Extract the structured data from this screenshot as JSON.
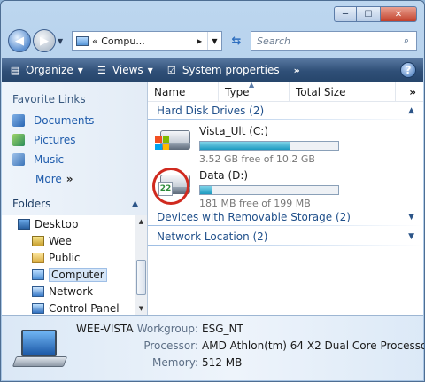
{
  "window": {
    "caption_buttons": {
      "minimize": "─",
      "maximize": "☐",
      "close": "✕"
    }
  },
  "addressbar": {
    "prefix": "«",
    "crumb": "Compu...",
    "search_placeholder": "Search"
  },
  "toolbar": {
    "organize": "Organize",
    "views": "Views",
    "system_properties": "System properties",
    "more": "»",
    "help": "?"
  },
  "favorites": {
    "title": "Favorite Links",
    "items": [
      {
        "label": "Documents",
        "icon": "documents-icon"
      },
      {
        "label": "Pictures",
        "icon": "pictures-icon"
      },
      {
        "label": "Music",
        "icon": "music-icon"
      }
    ],
    "more": "More",
    "more_glyph": "»"
  },
  "folders": {
    "title": "Folders",
    "tree": [
      {
        "label": "Desktop",
        "level": 0
      },
      {
        "label": "Wee",
        "level": 1
      },
      {
        "label": "Public",
        "level": 1
      },
      {
        "label": "Computer",
        "level": 1,
        "selected": true
      },
      {
        "label": "Network",
        "level": 1
      },
      {
        "label": "Control Panel",
        "level": 1
      }
    ]
  },
  "columns": {
    "name": "Name",
    "type": "Type",
    "total_size": "Total Size",
    "more": "»"
  },
  "groups": {
    "hard_disk": "Hard Disk Drives (2)",
    "removable": "Devices with Removable Storage (2)",
    "network": "Network Location (2)"
  },
  "drives": [
    {
      "name": "Vista_Ult (C:)",
      "free": "3.52 GB free of 10.2 GB",
      "used_fraction": 0.655
    },
    {
      "name": "Data (D:)",
      "free": "181 MB free of 199 MB",
      "used_fraction": 0.09
    }
  ],
  "details": {
    "computer_name": "WEE-VISTA",
    "workgroup_label": "Workgroup:",
    "workgroup": "ESG_NT",
    "processor_label": "Processor:",
    "processor": "AMD Athlon(tm) 64 X2 Dual Core Processo...",
    "memory_label": "Memory:",
    "memory": "512 MB"
  },
  "colors": {
    "accent": "#1f5cac",
    "toolbar": "#2f4f77",
    "bar_fill": "#1b9ac0",
    "highlight_circle": "#d02a1f"
  }
}
